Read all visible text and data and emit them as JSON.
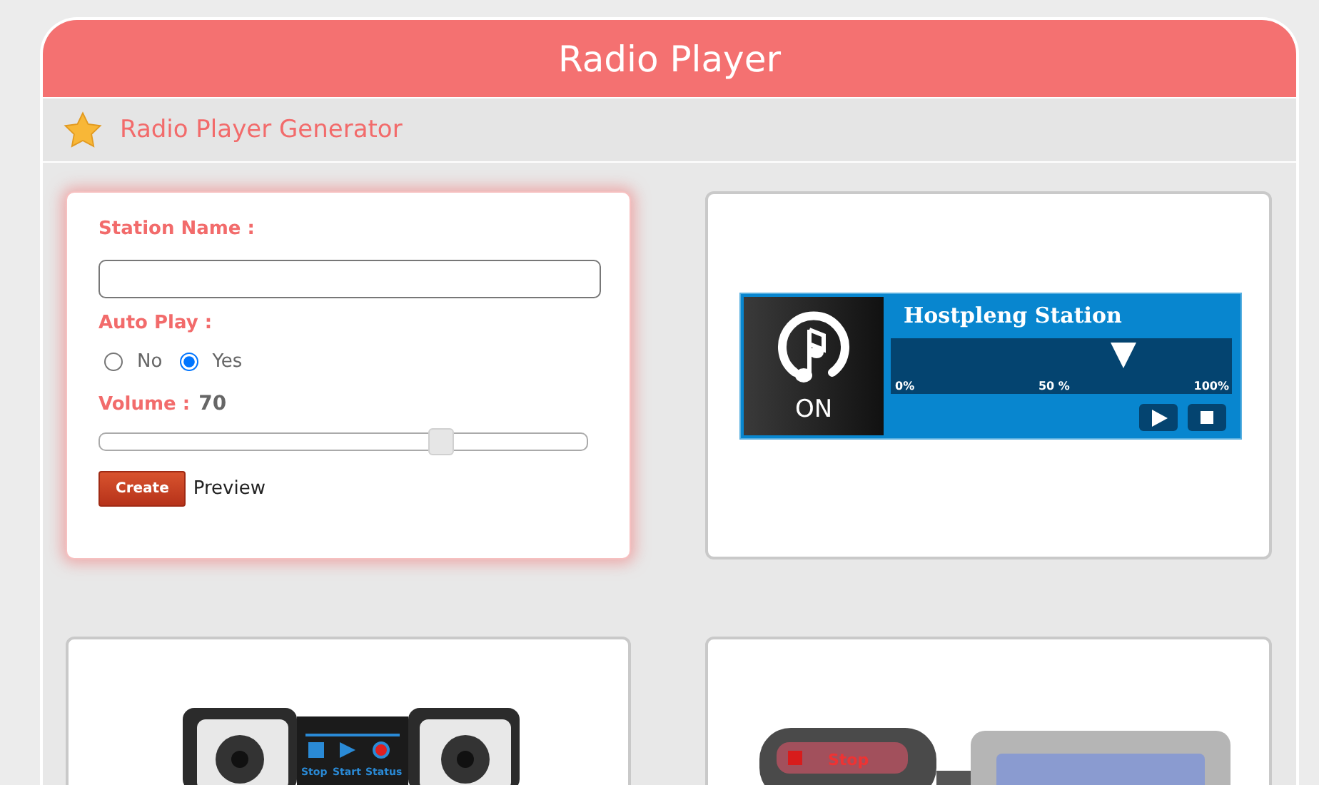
{
  "window": {
    "title": "Radio Player"
  },
  "section": {
    "title": "Radio Player Generator"
  },
  "form": {
    "station_label": "Station Name :",
    "autoplay_label": "Auto Play :",
    "autoplay_options": [
      {
        "label": "No",
        "selected": false
      },
      {
        "label": "Yes",
        "selected": true
      }
    ],
    "volume_label": "Volume :",
    "volume_value": "70",
    "volume": {
      "level": 0.7
    },
    "create_button": "Create",
    "preview_label": "Preview"
  },
  "preview_player": {
    "station": "Hostpleng Station",
    "power_label": "ON",
    "position": {
      "level": 0.68
    },
    "scale": [
      "0%",
      "50 %",
      "100%"
    ]
  },
  "players": [
    {
      "kind": "boombox",
      "buttons": [
        "Stop",
        "Start",
        "Status"
      ]
    },
    {
      "kind": "capsule",
      "buttons": [
        "Stop"
      ]
    }
  ]
}
